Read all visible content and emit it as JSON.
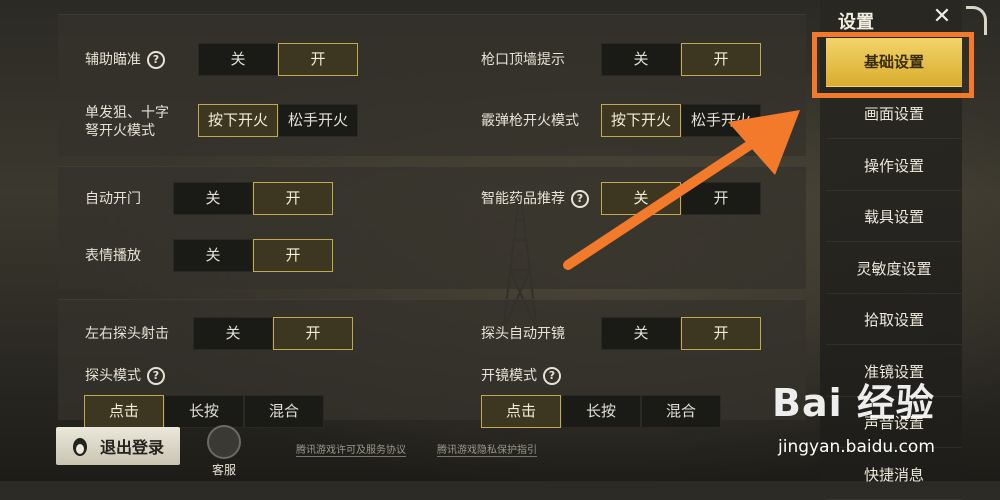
{
  "panel1": {
    "aim_assist": {
      "label": "辅助瞄准",
      "off": "关",
      "on": "开",
      "selected": "on"
    },
    "muzzle_hint": {
      "label": "枪口顶墙提示",
      "off": "关",
      "on": "开",
      "selected": "on"
    },
    "sniper_fire_mode": {
      "label_line1": "单发狙、十字",
      "label_line2": "弩开火模式",
      "press": "按下开火",
      "release": "松手开火",
      "selected": "press"
    },
    "shotgun_fire_mode": {
      "label": "霰弹枪开火模式",
      "press": "按下开火",
      "release": "松手开火",
      "selected": "press"
    }
  },
  "panel2": {
    "auto_door": {
      "label": "自动开门",
      "off": "关",
      "on": "开",
      "selected": "on"
    },
    "smart_meds": {
      "label": "智能药品推荐",
      "off": "关",
      "on": "开",
      "selected": "off"
    },
    "emote_play": {
      "label": "表情播放",
      "off": "关",
      "on": "开",
      "selected": "on"
    }
  },
  "panel3": {
    "peek_fire": {
      "label": "左右探头射击",
      "off": "关",
      "on": "开",
      "selected": "on"
    },
    "peek_auto_scope": {
      "label": "探头自动开镜",
      "off": "关",
      "on": "开",
      "selected": "on"
    },
    "peek_mode": {
      "label": "探头模式",
      "options": [
        "点击",
        "长按",
        "混合"
      ],
      "selected": 0
    },
    "scope_mode": {
      "label": "开镜模式",
      "options": [
        "点击",
        "长按",
        "混合"
      ],
      "selected": 0
    }
  },
  "sidebar": {
    "title": "设置",
    "items": [
      "基础设置",
      "画面设置",
      "操作设置",
      "载具设置",
      "灵敏度设置",
      "拾取设置",
      "准镜设置",
      "声音设置",
      "快捷消息"
    ],
    "active": 0
  },
  "bottom": {
    "logout": "退出登录",
    "service": "客服",
    "license_link": "腾讯游戏许可及服务协议",
    "privacy_link": "腾讯游戏隐私保护指引"
  },
  "watermark": {
    "main": "Bai 经验",
    "sub": "jingyan.baidu.com"
  },
  "colors": {
    "accent": "#c3a94d",
    "active_menu": "#e8c04a",
    "highlight": "#f27a2a"
  }
}
